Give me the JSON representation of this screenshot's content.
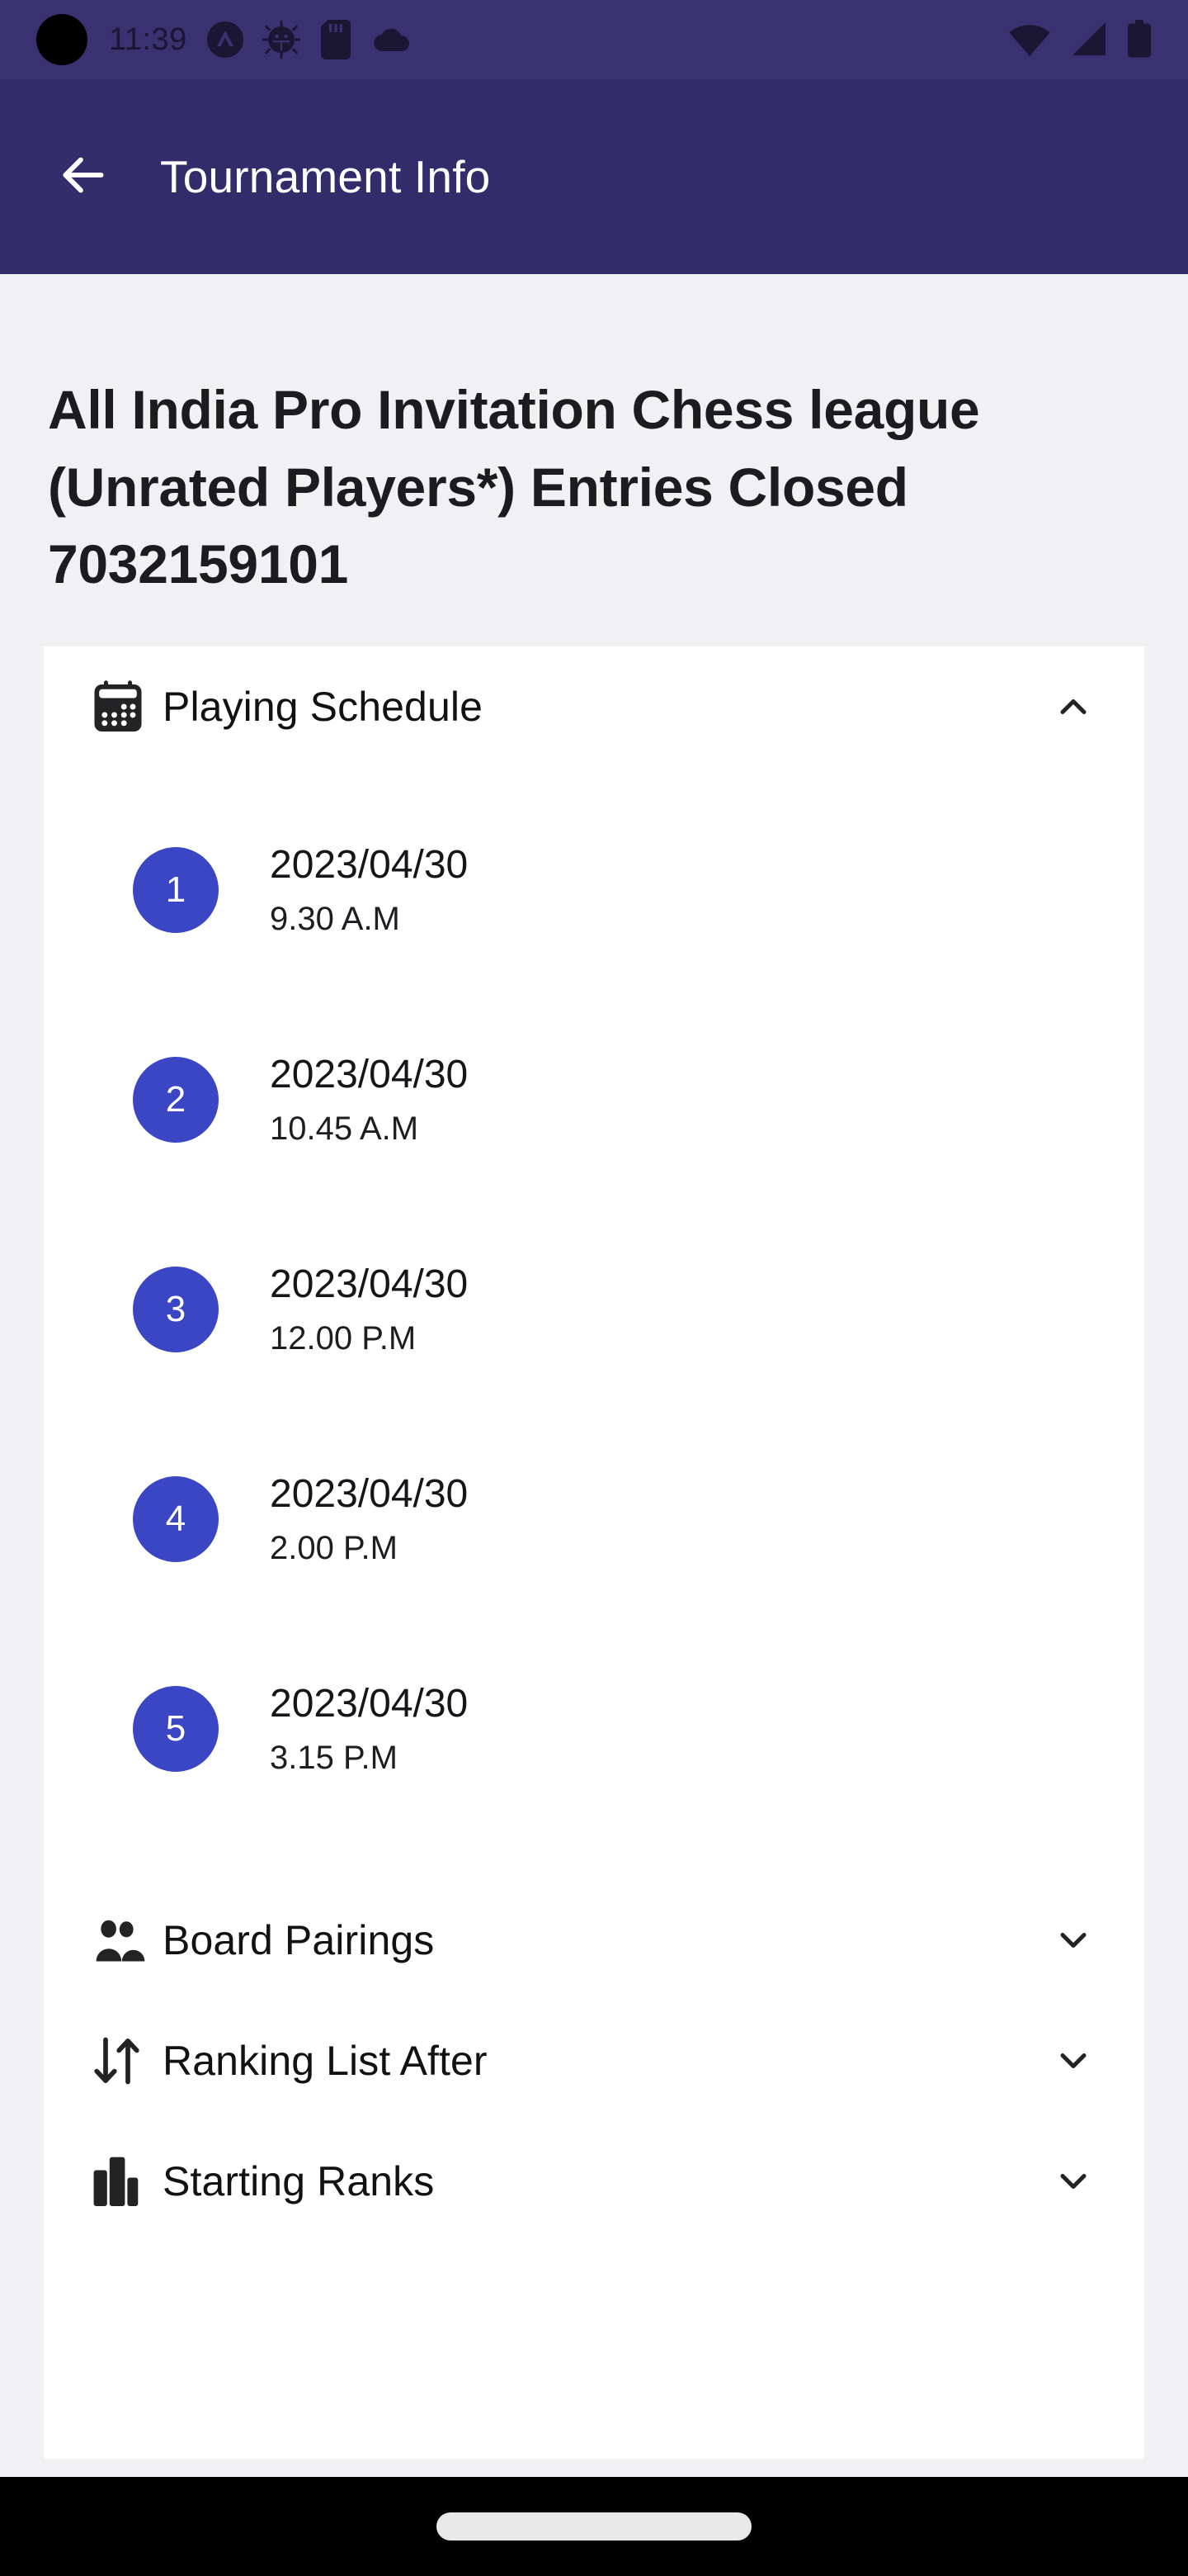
{
  "status_bar": {
    "time": "11:39",
    "left_icons": [
      "camera-punch-hole",
      "caret-circle-icon",
      "bug-icon",
      "sd-card-icon",
      "cloud-icon"
    ],
    "right_icons": [
      "wifi-icon",
      "cellular-signal-icon",
      "battery-icon"
    ],
    "background_color": "#3a3270",
    "icon_color": "#1a1633"
  },
  "app_bar": {
    "back_icon": "arrow-left-icon",
    "title": "Tournament Info",
    "background_color": "#332c6b",
    "text_color": "#ffffff"
  },
  "page": {
    "background_color": "#f1f1f3",
    "title": "All India Pro Invitation Chess league (Unrated Players*) Entries Closed 7032159101"
  },
  "card": {
    "background_color": "#ffffff",
    "sections": [
      {
        "id": "playing-schedule",
        "label": "Playing Schedule",
        "icon": "calendar-icon",
        "expanded": true,
        "chevron": "chevron-up-icon"
      },
      {
        "id": "board-pairings",
        "label": "Board Pairings",
        "icon": "people-group-icon",
        "expanded": false,
        "chevron": "chevron-down-icon"
      },
      {
        "id": "ranking-list-after",
        "label": "Ranking List After",
        "icon": "sort-arrows-icon",
        "expanded": false,
        "chevron": "chevron-down-icon"
      },
      {
        "id": "starting-ranks",
        "label": "Starting Ranks",
        "icon": "bar-chart-icon",
        "expanded": false,
        "chevron": "chevron-down-icon"
      }
    ]
  },
  "schedule": {
    "badge_color": "#3b46c4",
    "rounds": [
      {
        "number": "1",
        "date": "2023/04/30",
        "time": "9.30 A.M"
      },
      {
        "number": "2",
        "date": "2023/04/30",
        "time": "10.45 A.M"
      },
      {
        "number": "3",
        "date": "2023/04/30",
        "time": "12.00 P.M"
      },
      {
        "number": "4",
        "date": "2023/04/30",
        "time": "2.00 P.M"
      },
      {
        "number": "5",
        "date": "2023/04/30",
        "time": "3.15 P.M"
      }
    ]
  },
  "navigation_bar": {
    "background_color": "#000000",
    "gesture_pill": "home-gesture-pill"
  }
}
